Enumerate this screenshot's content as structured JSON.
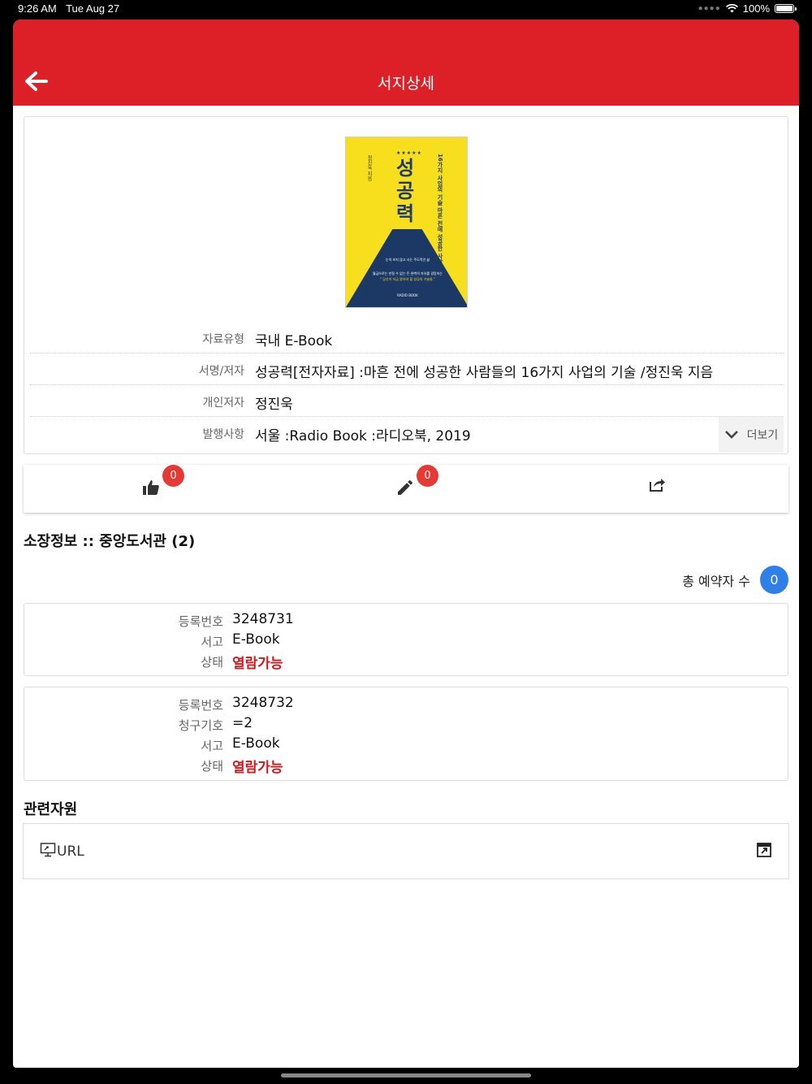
{
  "status_bar": {
    "time": "9:26 AM",
    "date": "Tue Aug 27",
    "battery": "100%",
    "colors": {
      "background": "#000000"
    }
  },
  "header": {
    "title": "서지상세",
    "back_icon": "arrow-left-icon",
    "color": "#dd2027"
  },
  "book": {
    "cover": {
      "title": "성공력",
      "title_suffix": "力",
      "subtitle": "16가지 사업의 기술 마흔 전에 성공한 사람들의",
      "author": "정진욱 지음",
      "tagline1": "하고 싶은 일을 하는 행복",
      "tagline2": "눈치 보지 않고 사는 주도적인 삶",
      "tagline3": "월급으로는 만질 수 없는 돈 완벽히 자유를 갈망하는",
      "tagline4": "\" 당신이 지금 알아야 할 성공의 기술들 \"",
      "publisher": "RADIO BOOK",
      "colors": {
        "background": "#f7df1e",
        "mountain": "#1c3965"
      }
    },
    "fields": [
      {
        "label": "자료유형",
        "value": "국내 E-Book"
      },
      {
        "label": "서명/저자",
        "value": "성공력[전자자료]  :마흔 전에 성공한 사람들의 16가지 사업의 기술  /정진욱 지음"
      },
      {
        "label": "개인저자",
        "value": "정진욱"
      },
      {
        "label": "발행사항",
        "value": "서울   :Radio Book  :라디오북, 2019"
      }
    ],
    "more_label": "더보기"
  },
  "actions": {
    "like": {
      "icon": "thumbs-up-icon",
      "count": "0"
    },
    "review": {
      "icon": "pencil-icon",
      "count": "0"
    },
    "share": {
      "icon": "share-icon"
    },
    "badge_color": "#e53935"
  },
  "holdings": {
    "title": "소장정보 :: 중앙도서관 (2)",
    "reserve_label": "총 예약자 수",
    "reserve_count": "0",
    "items": [
      {
        "reg_label": "등록번호",
        "reg_no": "3248731",
        "loc_label": "서고",
        "location": "E-Book",
        "status_label": "상태",
        "status": "열람가능"
      },
      {
        "reg_label": "등록번호",
        "reg_no": "3248732",
        "call_label": "청구기호",
        "call_no": "=2",
        "loc_label": "서고",
        "location": "E-Book",
        "status_label": "상태",
        "status": "열람가능"
      }
    ],
    "status_color": "#d0181f"
  },
  "related": {
    "title": "관련자원",
    "items": [
      {
        "icon": "monitor-icon",
        "label": "URL",
        "link_icon": "external-link-icon"
      }
    ]
  }
}
